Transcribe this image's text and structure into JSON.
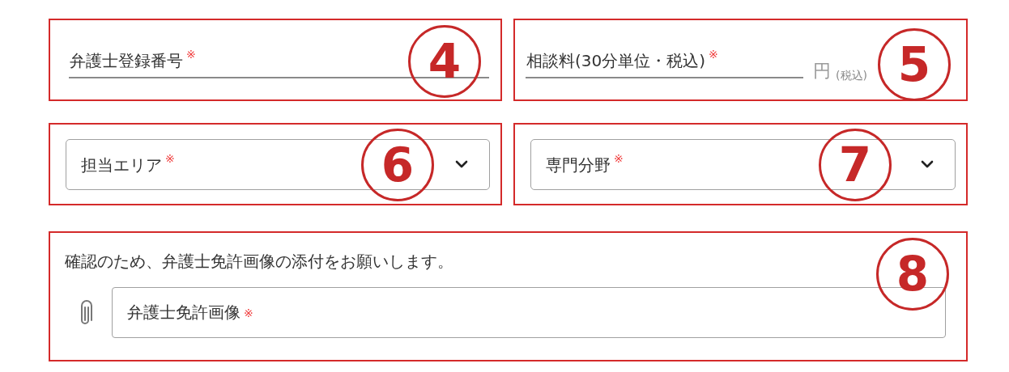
{
  "fields": [
    {
      "kind": "text",
      "label": "弁護士登録番号",
      "required_mark": "※",
      "callout": "4"
    },
    {
      "kind": "text",
      "label": "相談料(30分単位・税込)",
      "required_mark": "※",
      "unit": "円",
      "unit_note": "(税込)",
      "callout": "5"
    },
    {
      "kind": "select",
      "label": "担当エリア",
      "required_mark": "※",
      "callout": "6"
    },
    {
      "kind": "select",
      "label": "専門分野",
      "required_mark": "※",
      "callout": "7"
    },
    {
      "kind": "file",
      "note": "確認のため、弁護士免許画像の添付をお願いします。",
      "label": "弁護士免許画像",
      "required_mark": "※",
      "callout": "8"
    }
  ]
}
